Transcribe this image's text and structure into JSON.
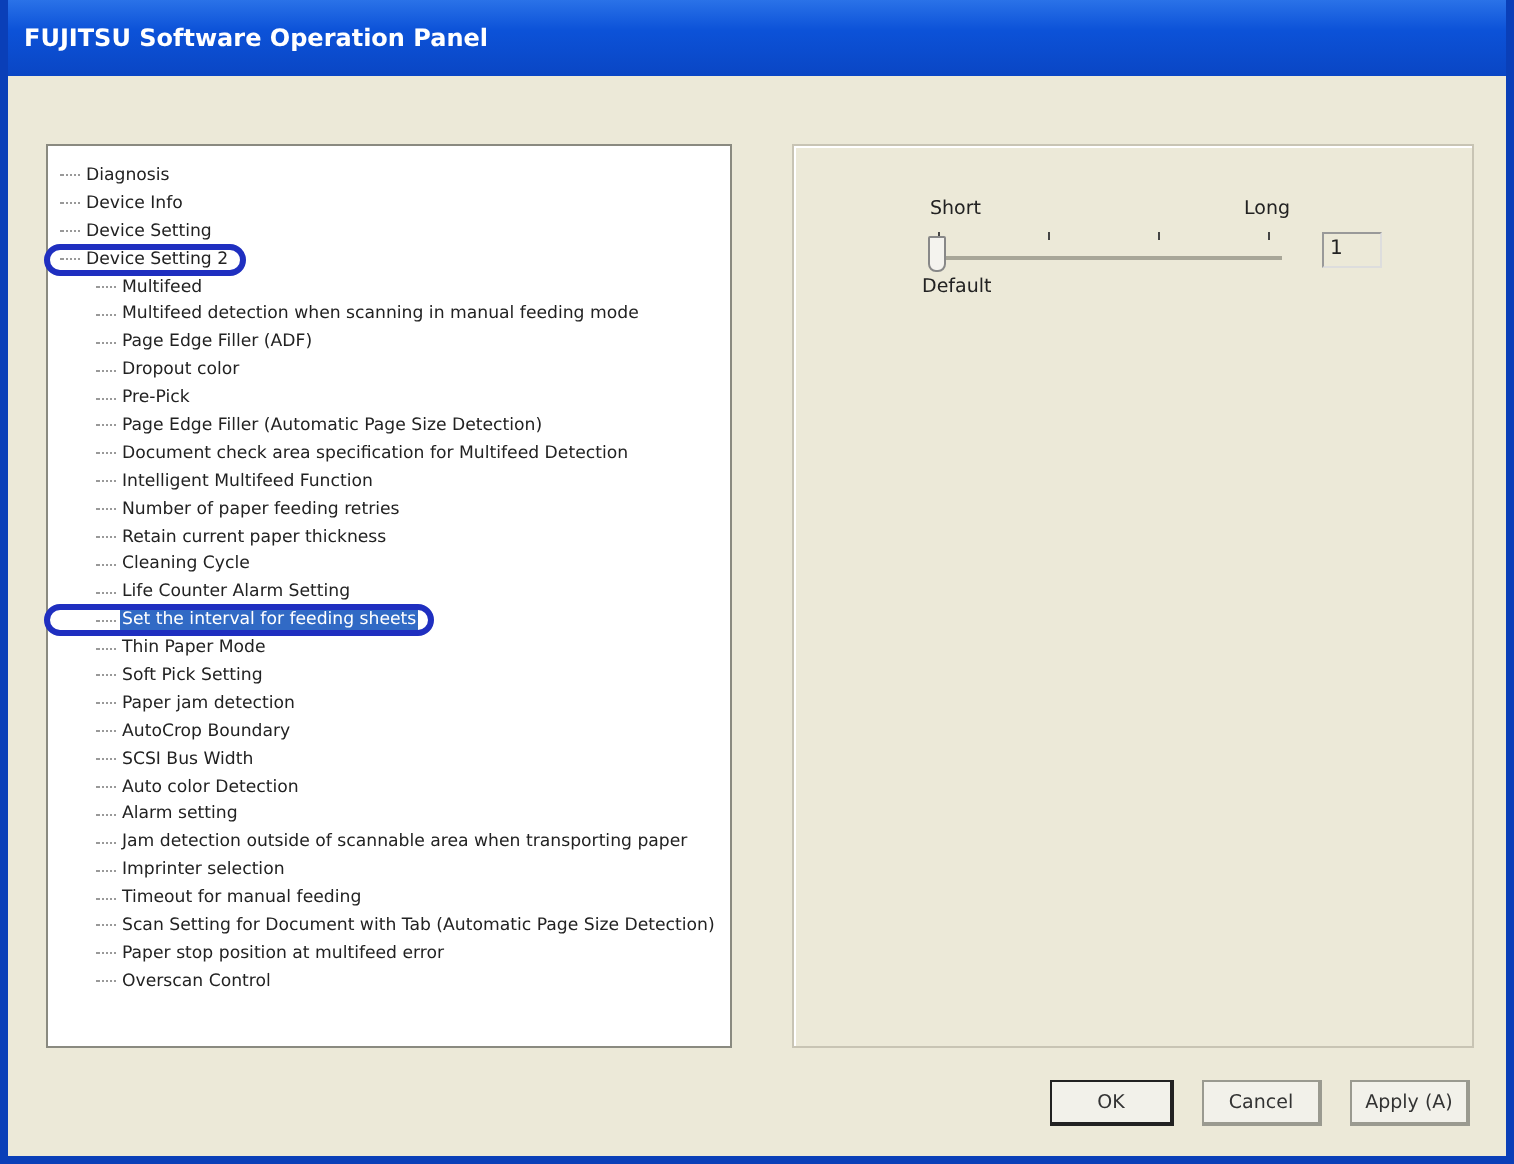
{
  "window": {
    "title": "FUJITSU Software Operation Panel"
  },
  "tree": [
    {
      "label": "Diagnosis",
      "selected": false,
      "circled": false
    },
    {
      "label": "Device Info",
      "selected": false,
      "circled": false
    },
    {
      "label": "Device Setting",
      "selected": false,
      "circled": false
    },
    {
      "label": "Device Setting 2",
      "selected": false,
      "circled": true,
      "children": [
        {
          "label": "Multifeed",
          "selected": false,
          "circled": false
        },
        {
          "label": "Multifeed detection when scanning in manual feeding mode",
          "selected": false,
          "circled": false
        },
        {
          "label": "Page Edge Filler (ADF)",
          "selected": false,
          "circled": false
        },
        {
          "label": "Dropout color",
          "selected": false,
          "circled": false
        },
        {
          "label": "Pre-Pick",
          "selected": false,
          "circled": false
        },
        {
          "label": "Page Edge Filler (Automatic Page Size Detection)",
          "selected": false,
          "circled": false
        },
        {
          "label": "Document check area specification for Multifeed Detection",
          "selected": false,
          "circled": false
        },
        {
          "label": "Intelligent Multifeed Function",
          "selected": false,
          "circled": false
        },
        {
          "label": "Number of paper feeding retries",
          "selected": false,
          "circled": false
        },
        {
          "label": "Retain current paper thickness",
          "selected": false,
          "circled": false
        },
        {
          "label": "Cleaning Cycle",
          "selected": false,
          "circled": false
        },
        {
          "label": "Life Counter Alarm Setting",
          "selected": false,
          "circled": false
        },
        {
          "label": "Set the interval for feeding sheets",
          "selected": true,
          "circled": true
        },
        {
          "label": "Thin Paper Mode",
          "selected": false,
          "circled": false
        },
        {
          "label": "Soft Pick Setting",
          "selected": false,
          "circled": false
        },
        {
          "label": "Paper jam detection",
          "selected": false,
          "circled": false
        },
        {
          "label": "AutoCrop Boundary",
          "selected": false,
          "circled": false
        },
        {
          "label": "SCSI Bus Width",
          "selected": false,
          "circled": false
        },
        {
          "label": "Auto color Detection",
          "selected": false,
          "circled": false
        },
        {
          "label": "Alarm setting",
          "selected": false,
          "circled": false
        },
        {
          "label": "Jam detection outside of scannable area when transporting paper",
          "selected": false,
          "circled": false
        },
        {
          "label": "Imprinter selection",
          "selected": false,
          "circled": false
        },
        {
          "label": "Timeout for manual feeding",
          "selected": false,
          "circled": false
        },
        {
          "label": "Scan Setting for Document with Tab (Automatic Page Size Detection)",
          "selected": false,
          "circled": false
        },
        {
          "label": "Paper stop position at multifeed error",
          "selected": false,
          "circled": false
        },
        {
          "label": "Overscan Control",
          "selected": false,
          "circled": false
        }
      ]
    }
  ],
  "setting": {
    "min_label": "Short",
    "max_label": "Long",
    "default_label": "Default",
    "level": 0,
    "value": "1"
  },
  "buttons": [
    {
      "label": "OK",
      "kind": "default"
    },
    {
      "label": "Cancel",
      "kind": "normal"
    },
    {
      "label": "Apply (A)",
      "kind": "normal"
    }
  ]
}
